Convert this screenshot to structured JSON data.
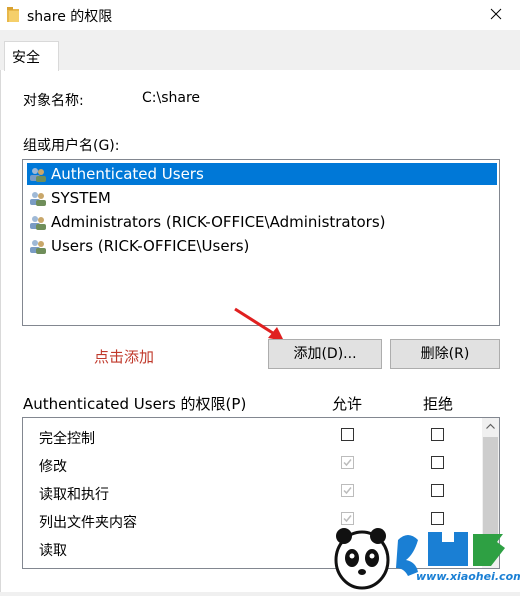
{
  "window": {
    "title": "share 的权限"
  },
  "tabs": [
    {
      "label": "安全"
    }
  ],
  "object": {
    "label": "对象名称:",
    "value": "C:\\share"
  },
  "groups": {
    "label": "组或用户名(G):",
    "items": [
      {
        "name": "Authenticated Users",
        "selected": true
      },
      {
        "name": "SYSTEM",
        "selected": false
      },
      {
        "name": "Administrators (RICK-OFFICE\\Administrators)",
        "selected": false
      },
      {
        "name": "Users (RICK-OFFICE\\Users)",
        "selected": false
      }
    ]
  },
  "annotation": {
    "text": "点击添加",
    "color": "#c0392b"
  },
  "buttons": {
    "add": "添加(D)...",
    "remove": "删除(R)"
  },
  "permissions": {
    "label": "Authenticated Users 的权限(P)",
    "allow_header": "允许",
    "deny_header": "拒绝",
    "rows": [
      {
        "name": "完全控制",
        "allow": "unchecked",
        "deny": "unchecked"
      },
      {
        "name": "修改",
        "allow": "checked-disabled",
        "deny": "unchecked"
      },
      {
        "name": "读取和执行",
        "allow": "checked-disabled",
        "deny": "unchecked"
      },
      {
        "name": "列出文件夹内容",
        "allow": "checked-disabled",
        "deny": "unchecked"
      },
      {
        "name": "读取",
        "allow": "checked-disabled",
        "deny": "unchecked"
      }
    ]
  },
  "watermark": {
    "text": "www.xiaohei.com"
  },
  "colors": {
    "selection": "#0078d7",
    "button": "#e1e1e1"
  }
}
